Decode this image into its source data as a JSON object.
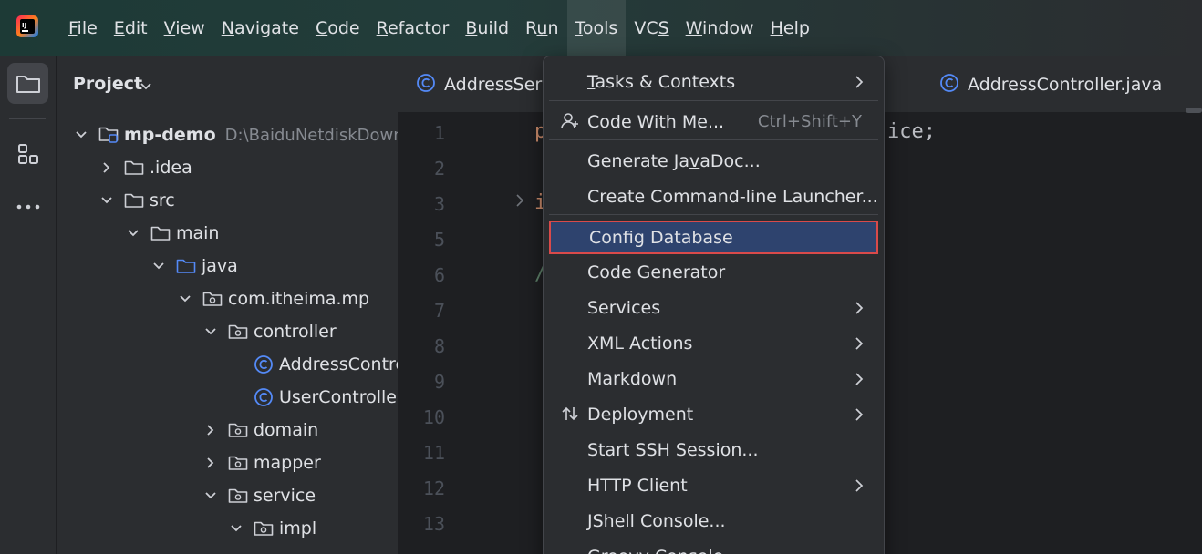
{
  "menubar": {
    "items": [
      {
        "label": "File",
        "mnemonic": 0
      },
      {
        "label": "Edit",
        "mnemonic": 0
      },
      {
        "label": "View",
        "mnemonic": 0
      },
      {
        "label": "Navigate",
        "mnemonic": 0
      },
      {
        "label": "Code",
        "mnemonic": 0
      },
      {
        "label": "Refactor",
        "mnemonic": 0
      },
      {
        "label": "Build",
        "mnemonic": 0
      },
      {
        "label": "Run",
        "mnemonic": 1
      },
      {
        "label": "Tools",
        "mnemonic": 0
      },
      {
        "label": "VCS",
        "mnemonic": 2
      },
      {
        "label": "Window",
        "mnemonic": 0
      },
      {
        "label": "Help",
        "mnemonic": 0
      }
    ],
    "active": "Tools"
  },
  "toolstrip": {
    "icons": [
      "project-folder-icon",
      "structure-icon",
      "more-icon"
    ]
  },
  "project_panel": {
    "title": "Project",
    "tree": [
      {
        "label": "mp-demo",
        "hint": "D:\\BaiduNetdiskDownl",
        "expanded": true,
        "icon": "module-icon"
      },
      {
        "label": ".idea",
        "expanded": false,
        "icon": "folder-icon"
      },
      {
        "label": "src",
        "expanded": true,
        "icon": "folder-icon"
      },
      {
        "label": "main",
        "expanded": true,
        "icon": "folder-icon"
      },
      {
        "label": "java",
        "expanded": true,
        "icon": "source-folder-icon"
      },
      {
        "label": "com.itheima.mp",
        "expanded": true,
        "icon": "package-icon"
      },
      {
        "label": "controller",
        "expanded": true,
        "icon": "package-icon"
      },
      {
        "label": "AddressContro",
        "icon": "class-icon"
      },
      {
        "label": "UserController",
        "icon": "class-icon"
      },
      {
        "label": "domain",
        "expanded": false,
        "icon": "package-icon"
      },
      {
        "label": "mapper",
        "expanded": false,
        "icon": "package-icon"
      },
      {
        "label": "service",
        "expanded": true,
        "icon": "package-icon"
      },
      {
        "label": "impl",
        "expanded": true,
        "icon": "package-icon"
      }
    ]
  },
  "editor": {
    "tabs": [
      "AddressServi",
      "AddressController.java"
    ],
    "line_numbers": [
      "1",
      "2",
      "3",
      "5",
      "6",
      "7",
      "8",
      "9",
      "10",
      "11",
      "12",
      "13"
    ],
    "code_fragments": {
      "line1_left": "p",
      "line1_right": "ice;",
      "line3": "i",
      "line6": "/"
    }
  },
  "tools_menu": {
    "items": [
      {
        "label": "Tasks & Contexts",
        "mnemonic": 0,
        "submenu": true
      },
      {
        "label": "Code With Me...",
        "shortcut": "Ctrl+Shift+Y",
        "icon": "code-with-me-icon"
      },
      {
        "label": "Generate JavaDoc...",
        "mnemonic": 11
      },
      {
        "label": "Create Command-line Launcher..."
      },
      {
        "label": "Config Database",
        "selected": true
      },
      {
        "label": "Code Generator"
      },
      {
        "label": "Services",
        "submenu": true
      },
      {
        "label": "XML Actions",
        "submenu": true
      },
      {
        "label": "Markdown",
        "submenu": true
      },
      {
        "label": "Deployment",
        "submenu": true,
        "icon": "deployment-icon"
      },
      {
        "label": "Start SSH Session..."
      },
      {
        "label": "HTTP Client",
        "submenu": true
      },
      {
        "label": "JShell Console..."
      },
      {
        "label": "Groovy Console"
      }
    ]
  },
  "colors": {
    "accent": "#3574f0",
    "selection": "#2e436e",
    "highlight_border": "#d94a4a"
  }
}
